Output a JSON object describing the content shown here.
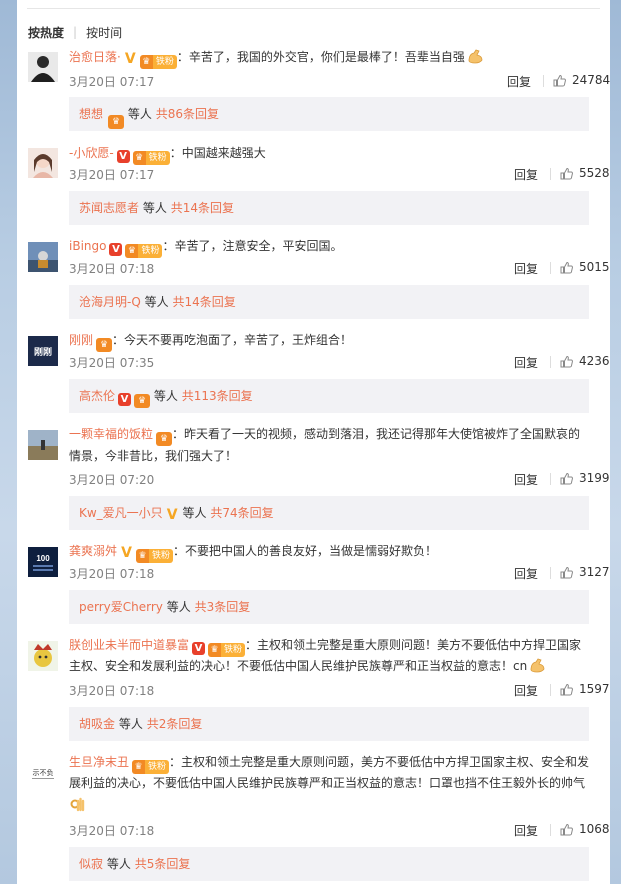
{
  "sort": {
    "hot": "按热度",
    "time": "按时间"
  },
  "comments": [
    {
      "user": "治愈日落·",
      "text": "：辛苦了，我国的外交官，你们是最棒了！吾辈当自强",
      "time": "3月20日 07:17",
      "reply": "回复",
      "likes": "24784",
      "sub_user": "想想",
      "sub_more": "等人",
      "sub_count": "共86条回复"
    },
    {
      "user": "-小欣愿-",
      "text": "：中国越来越强大",
      "time": "3月20日 07:17",
      "reply": "回复",
      "likes": "5528",
      "sub_user": "苏闻志愿者",
      "sub_more": "等人",
      "sub_count": "共14条回复"
    },
    {
      "user": "iBingo",
      "text": "：辛苦了，注意安全，平安回国。",
      "time": "3月20日 07:18",
      "reply": "回复",
      "likes": "5015",
      "sub_user": "沧海月明-Q",
      "sub_more": "等人",
      "sub_count": "共14条回复"
    },
    {
      "user": "刚刚",
      "text": "：今天不要再吃泡面了，辛苦了，王炸组合！",
      "time": "3月20日 07:35",
      "reply": "回复",
      "likes": "4236",
      "sub_user": "高杰伦",
      "sub_more": "等人",
      "sub_count": "共113条回复"
    },
    {
      "user": "一颗幸福的饭粒",
      "text_line1": "：昨天看了一天的视频，感动到落泪，我还记得那年大使馆被炸了全国默哀的",
      "text_line2": "情景，今非昔比，我们强大了！",
      "time": "3月20日 07:20",
      "reply": "回复",
      "likes": "3199",
      "sub_user": "Kw_爱凡一小只",
      "sub_more": "等人",
      "sub_count": "共74条回复"
    },
    {
      "user": "龚爽溺舛",
      "text": "：不要把中国人的善良友好，当做是懦弱好欺负！",
      "time": "3月20日 07:18",
      "reply": "回复",
      "likes": "3127",
      "sub_user": "perry爱Cherry",
      "sub_more": "等人",
      "sub_count": "共3条回复"
    },
    {
      "user": "朕创业未半而中道暴富",
      "text_line1": "：主权和领土完整是重大原则问题！美方不要低估中方捍卫国家",
      "text_line2": "主权、安全和发展利益的决心！不要低估中国人民维护民族尊严和正当权益的意志！cn",
      "time": "3月20日 07:18",
      "reply": "回复",
      "likes": "1597",
      "sub_user": "胡吸金",
      "sub_more": "等人",
      "sub_count": "共2条回复"
    },
    {
      "user": "生旦净末丑",
      "text_line1": "：主权和领土完整是重大原则问题，美方不要低估中方捍卫国家主权、安全和发",
      "text_line2": "展利益的决心，不要低估中国人民维护民族尊严和正当权益的意志！口罩也挡不住王毅外长的帅气",
      "time": "3月20日 07:18",
      "reply": "回复",
      "likes": "1068",
      "sub_user": "似寂",
      "sub_more": "等人",
      "sub_count": "共5条回复"
    }
  ],
  "badges": {
    "fan": "铁粉",
    "v": "V"
  },
  "colors": {
    "link": "#eb7350",
    "gold_v": "#f5a623",
    "red_v": "#e8402b"
  }
}
